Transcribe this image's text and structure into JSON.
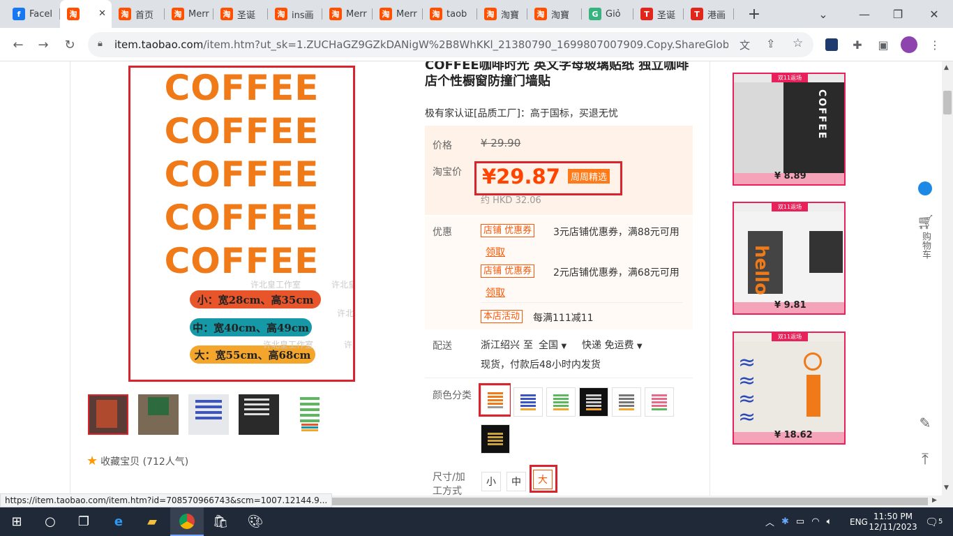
{
  "browser": {
    "tabs": [
      {
        "title": "Facel",
        "icon": "facebook-icon",
        "color": "#1877f2"
      },
      {
        "title": "",
        "icon": "taobao-icon",
        "color": "#ff5000",
        "active": true
      },
      {
        "title": "首页",
        "icon": "taobao-icon",
        "color": "#ff5000"
      },
      {
        "title": "Merr",
        "icon": "taobao-icon",
        "color": "#ff5000"
      },
      {
        "title": "圣诞",
        "icon": "taobao-icon",
        "color": "#ff5000"
      },
      {
        "title": "ins画",
        "icon": "taobao-icon",
        "color": "#ff5000"
      },
      {
        "title": "Merr",
        "icon": "taobao-icon",
        "color": "#ff5000"
      },
      {
        "title": "Merr",
        "icon": "taobao-icon",
        "color": "#ff5000"
      },
      {
        "title": "taob",
        "icon": "taobao-icon",
        "color": "#ff5000"
      },
      {
        "title": "淘寶",
        "icon": "taobao-icon",
        "color": "#ff5000"
      },
      {
        "title": "淘寶",
        "icon": "taobao-icon",
        "color": "#ff5000"
      },
      {
        "title": "Giỏ",
        "icon": "lazada-icon",
        "color": "#36b37e"
      },
      {
        "title": "圣诞",
        "icon": "t-brand-icon",
        "color": "#e1251b"
      },
      {
        "title": "港画",
        "icon": "t-brand-icon",
        "color": "#e1251b"
      }
    ],
    "url_host": "item.taobao.com",
    "url_path": "/item.htm?ut_sk=1.ZUCHaGZ9GZkDANigW%2B8WhKKl_21380790_1699807007909.Copy.ShareGlobalNa...",
    "status_url": "https://item.taobao.com/item.htm?id=708570966743&scm=1007.12144.9..."
  },
  "product": {
    "title": "COFFEE咖啡时光 英文字母玻璃贴纸 独立咖啡店个性橱窗防撞门墙贴",
    "certification": "极有家认证[品质工厂]：高于国标，买退无忧",
    "image_words": [
      "COFFEE",
      "COFFEE",
      "COFFEE",
      "COFFEE",
      "COFFEE"
    ],
    "size_bars": [
      {
        "text": "小：宽28cm、高35cm",
        "color": "#e8552b"
      },
      {
        "text": "中：宽40cm、高49cm",
        "color": "#1599a6"
      },
      {
        "text": "大：宽55cm、高68cm",
        "color": "#f3a52c"
      }
    ],
    "watermark": "许北皇工作室",
    "favorite": "收藏宝贝 (712人气)",
    "price_label": "价格",
    "original_price": "¥ 29.90",
    "taobao_price_label": "淘宝价",
    "price": "¥29.87",
    "price_tag": "周周精选",
    "hkd": "约 HKD 32.06",
    "promo_label": "优惠",
    "coupons": [
      {
        "tag": "店铺 优惠券",
        "text": "3元店铺优惠券，满88元可用",
        "action": "领取"
      },
      {
        "tag": "店铺 优惠券",
        "text": "2元店铺优惠券，满68元可用",
        "action": "领取"
      }
    ],
    "activity_tag": "本店活动",
    "activity_text": "每满111减11",
    "shipping_label": "配送",
    "ship_from": "浙江绍兴",
    "ship_to_word": "至",
    "ship_region": "全国",
    "ship_method": "快递 免运费",
    "ship_note": "现货，付款后48小时内发货",
    "color_label": "颜色分类",
    "size_label": "尺寸/加工方式",
    "sizes": [
      "小",
      "中",
      "大"
    ]
  },
  "recommendations": [
    {
      "price": "¥ 8.89",
      "badge": "双11返场"
    },
    {
      "price": "¥ 9.81",
      "badge": "双11返场"
    },
    {
      "price": "¥ 18.62",
      "badge": "双11返场"
    }
  ],
  "sidebar": {
    "cart_label": "购物车"
  },
  "taskbar": {
    "time": "11:50 PM",
    "date": "12/11/2023",
    "lang": "ENG",
    "notif_count": "5"
  }
}
